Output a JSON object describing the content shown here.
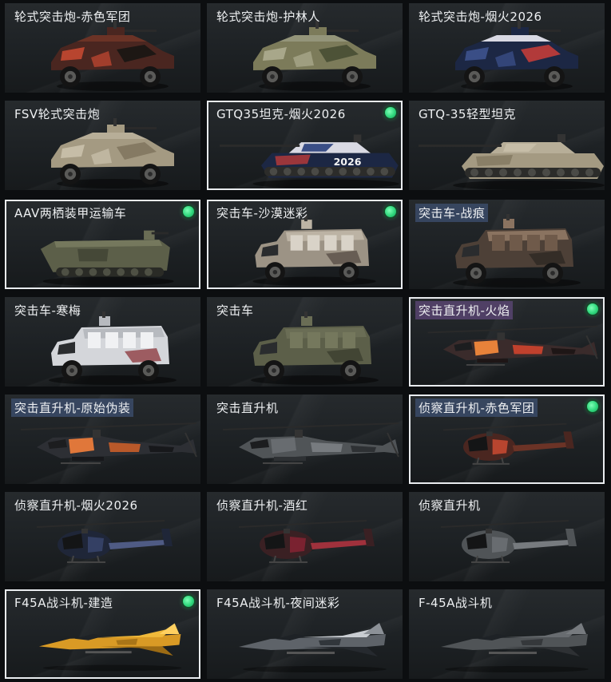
{
  "vehicles": [
    {
      "label": "轮式突击炮-赤色军团",
      "kind": "wheeled",
      "skin": "red",
      "owned": false
    },
    {
      "label": "轮式突击炮-护林人",
      "kind": "wheeled",
      "skin": "woodland",
      "owned": false
    },
    {
      "label": "轮式突击炮-烟火2026",
      "kind": "wheeled",
      "skin": "firework",
      "owned": false
    },
    {
      "label": "FSV轮式突击炮",
      "kind": "wheeled",
      "skin": "sand",
      "owned": false
    },
    {
      "label": "GTQ35坦克-烟火2026",
      "kind": "tank",
      "skin": "firework",
      "owned": true,
      "decal": "2026"
    },
    {
      "label": "GTQ-35轻型坦克",
      "kind": "tank",
      "skin": "sand",
      "owned": false
    },
    {
      "label": "AAV两栖装甲运输车",
      "kind": "amphib",
      "skin": "olive",
      "owned": true
    },
    {
      "label": "突击车-沙漠迷彩",
      "kind": "mrap",
      "skin": "desert",
      "owned": true
    },
    {
      "label": "突击车-战痕",
      "kind": "mrap",
      "skin": "rust",
      "owned": false,
      "tag": "blue"
    },
    {
      "label": "突击车-寒梅",
      "kind": "mrap",
      "skin": "snow",
      "owned": false
    },
    {
      "label": "突击车",
      "kind": "mrap",
      "skin": "olive",
      "owned": false
    },
    {
      "label": "突击直升机-火焰",
      "kind": "attack-heli",
      "skin": "flame",
      "owned": true,
      "tag": "purple"
    },
    {
      "label": "突击直升机-原始伪装",
      "kind": "attack-heli",
      "skin": "tiger",
      "owned": false,
      "tag": "blue"
    },
    {
      "label": "突击直升机",
      "kind": "attack-heli",
      "skin": "grey",
      "owned": false
    },
    {
      "label": "侦察直升机-赤色军团",
      "kind": "scout-heli",
      "skin": "red",
      "owned": true,
      "tag": "blue"
    },
    {
      "label": "侦察直升机-烟火2026",
      "kind": "scout-heli",
      "skin": "navy",
      "owned": false
    },
    {
      "label": "侦察直升机-酒红",
      "kind": "scout-heli",
      "skin": "wine",
      "owned": false
    },
    {
      "label": "侦察直升机",
      "kind": "scout-heli",
      "skin": "grey",
      "owned": false
    },
    {
      "label": "F45A战斗机-建造",
      "kind": "jet",
      "skin": "yellow",
      "owned": true
    },
    {
      "label": "F45A战斗机-夜间迷彩",
      "kind": "jet",
      "skin": "nightcamo",
      "owned": false
    },
    {
      "label": "F-45A战斗机",
      "kind": "jet",
      "skin": "grey",
      "owned": false
    }
  ],
  "selected_indices": [
    4,
    6,
    7,
    11,
    14,
    18
  ],
  "colors": {
    "owned_dot": "#2fd77c",
    "selected_border": "#e9ecef",
    "tag_blue": "#3c4e6e",
    "tag_purple": "#5c4676"
  }
}
